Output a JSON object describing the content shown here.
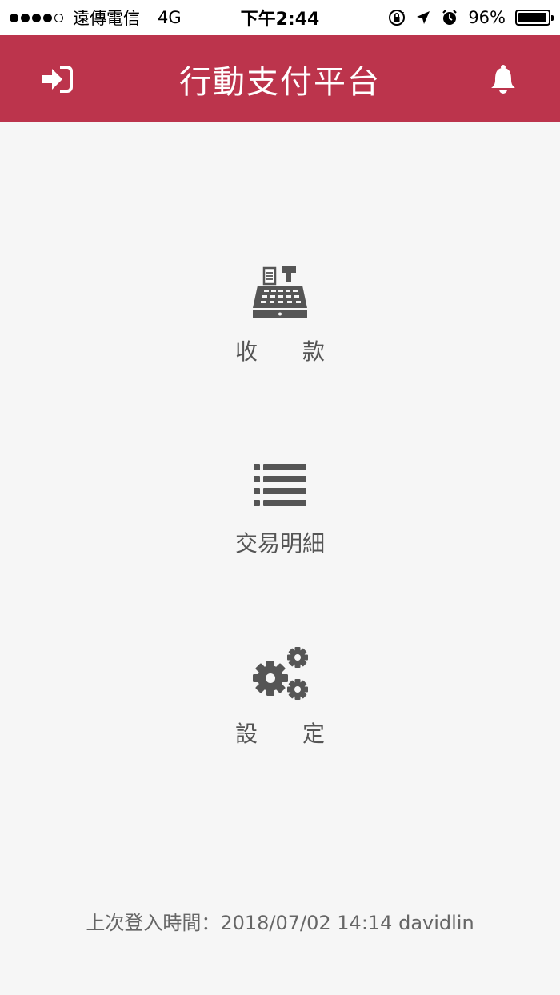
{
  "status_bar": {
    "signal_filled": 4,
    "signal_total": 5,
    "carrier": "遠傳電信",
    "network": "4G",
    "time": "下午2:44",
    "battery_text": "96%",
    "battery_level": 0.96,
    "icons": [
      "rotation-lock-icon",
      "location-arrow-icon",
      "alarm-icon",
      "battery-icon"
    ]
  },
  "header": {
    "title": "行動支付平台",
    "left_icon": "login-icon",
    "right_icon": "bell-icon",
    "background": "#bc344c"
  },
  "menu": {
    "items": [
      {
        "label": "收　　款",
        "icon": "cash-register-icon"
      },
      {
        "label": "交易明細",
        "icon": "list-icon"
      },
      {
        "label": "設　　定",
        "icon": "gears-icon"
      }
    ]
  },
  "footer": {
    "last_login_label": "上次登入時間：",
    "last_login_value": "2018/07/02 14:14 davidlin"
  },
  "colors": {
    "accent": "#bc344c",
    "icon_gray": "#555555",
    "background": "#f6f6f6"
  }
}
